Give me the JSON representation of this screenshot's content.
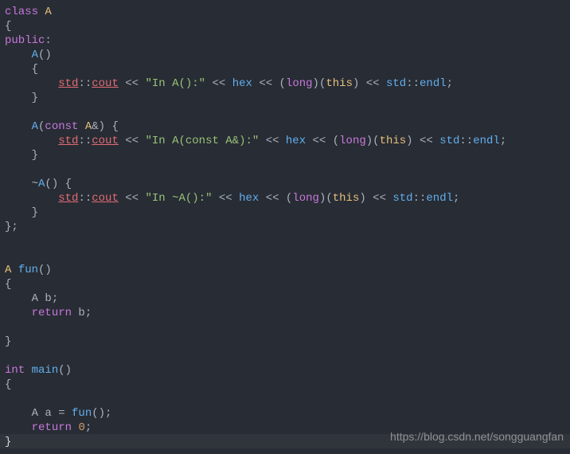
{
  "code": {
    "l1": {
      "class": "class",
      "A": "A"
    },
    "l2": {
      "brace": "{"
    },
    "l3": {
      "public": "public",
      "colon": ":"
    },
    "l4": {
      "A": "A",
      "parens": "()"
    },
    "l5": {
      "brace": "{"
    },
    "l6": {
      "std": "std",
      "scope": "::",
      "cout": "cout",
      "op1": " << ",
      "str": "\"In A():\"",
      "op2": " << ",
      "hex": "hex",
      "op3": " << (",
      "long": "long",
      "op4": ")(",
      "this": "this",
      "op5": ") << ",
      "std2": "std",
      "scope2": "::",
      "endl": "endl",
      "semi": ";"
    },
    "l7": {
      "brace": "}"
    },
    "l8": {
      "A": "A",
      "open": "(",
      "const": "const",
      "sp": " ",
      "A2": "A",
      "amp": "&) {"
    },
    "l9": {
      "std": "std",
      "scope": "::",
      "cout": "cout",
      "op1": " << ",
      "str": "\"In A(const A&):\"",
      "op2": " << ",
      "hex": "hex",
      "op3": " << (",
      "long": "long",
      "op4": ")(",
      "this": "this",
      "op5": ") << ",
      "std2": "std",
      "scope2": "::",
      "endl": "endl",
      "semi": ";"
    },
    "l10": {
      "brace": "}"
    },
    "l11": {
      "tilde": "~",
      "A": "A",
      "rest": "() {"
    },
    "l12": {
      "std": "std",
      "scope": "::",
      "cout": "cout",
      "op1": " << ",
      "str": "\"In ~A():\"",
      "op2": " << ",
      "hex": "hex",
      "op3": " << (",
      "long": "long",
      "op4": ")(",
      "this": "this",
      "op5": ") << ",
      "std2": "std",
      "scope2": "::",
      "endl": "endl",
      "semi": ";"
    },
    "l13": {
      "brace": "}"
    },
    "l14": {
      "brace": "};"
    },
    "l15": {
      "A": "A",
      "sp": " ",
      "fun": "fun",
      "parens": "()"
    },
    "l16": {
      "brace": "{"
    },
    "l17": {
      "text": "A b;"
    },
    "l18": {
      "return": "return",
      "rest": " b;"
    },
    "l19": {
      "brace": "}"
    },
    "l20": {
      "int": "int",
      "sp": " ",
      "main": "main",
      "parens": "()"
    },
    "l21": {
      "brace": "{"
    },
    "l22": {
      "text": "A a = ",
      "fun": "fun",
      "rest": "();"
    },
    "l23": {
      "return": "return",
      "sp": " ",
      "zero": "0",
      "semi": ";"
    },
    "l24": {
      "brace": "}"
    }
  },
  "watermark": "https://blog.csdn.net/songguangfan"
}
